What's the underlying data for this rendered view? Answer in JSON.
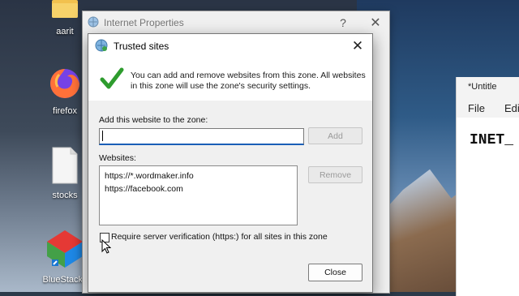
{
  "desktop": {
    "icons": [
      {
        "label": "aarit",
        "icon": "folder-icon"
      },
      {
        "label": "firefox",
        "icon": "firefox-icon"
      },
      {
        "label": "stocks",
        "icon": "file-icon"
      },
      {
        "label": "BlueStacks",
        "icon": "bluestacks-icon"
      }
    ]
  },
  "notepad": {
    "title": "*Untitle",
    "menu": [
      "File",
      "Edit"
    ],
    "content": "INET_"
  },
  "parent_window": {
    "title": "Internet Properties",
    "help_label": "?",
    "close_label": "✕"
  },
  "dialog": {
    "title": "Trusted sites",
    "close_label": "✕",
    "info_text": "You can add and remove websites from this zone. All websites in this zone will use the zone's security settings.",
    "add_label": "Add this website to the zone:",
    "add_input_value": "",
    "add_button": "Add",
    "websites_label": "Websites:",
    "websites": [
      "https://*.wordmaker.info",
      "https://facebook.com"
    ],
    "remove_button": "Remove",
    "require_https_label": "Require server verification (https:) for all sites in this zone",
    "require_https_checked": false,
    "close_button": "Close"
  },
  "colors": {
    "accent": "#1b5fb7",
    "check_green": "#2e9c2e"
  }
}
